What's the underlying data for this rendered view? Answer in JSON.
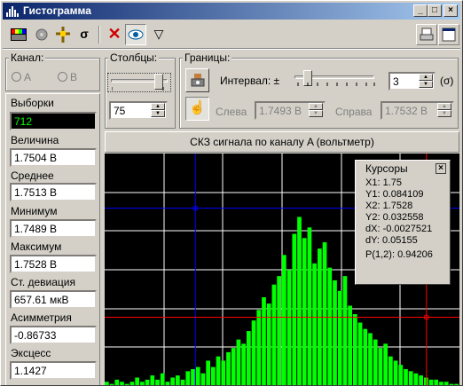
{
  "window": {
    "title": "Гистограмма"
  },
  "toolbar": {
    "tools": [
      "palette-icon",
      "gear-icon",
      "crosshair-icon",
      "sigma-icon",
      "delete-icon",
      "eye-icon",
      "triangle-icon"
    ],
    "right_tools": [
      "print-icon",
      "fullscreen-icon"
    ]
  },
  "channel": {
    "label": "Канал:",
    "a": "A",
    "b": "B"
  },
  "columns": {
    "label": "Столбцы:",
    "value": "75"
  },
  "bounds": {
    "label": "Границы:",
    "interval_label": "Интервал: ±",
    "interval_value": "3",
    "interval_unit": "(σ)",
    "left_label": "Слева",
    "left_value": "1.7493 В",
    "right_label": "Справа",
    "right_value": "1.7532 В"
  },
  "stats": {
    "samples_label": "Выборки",
    "samples_value": "712",
    "value_label": "Величина",
    "value_value": "1.7504 В",
    "mean_label": "Среднее",
    "mean_value": "1.7513 В",
    "min_label": "Минимум",
    "min_value": "1.7489 В",
    "max_label": "Максимум",
    "max_value": "1.7528 В",
    "std_label": "Ст. девиация",
    "std_value": "657.61 мкВ",
    "skew_label": "Асимметрия",
    "skew_value": "-0.86733",
    "kurt_label": "Эксцесс",
    "kurt_value": "1.1427"
  },
  "chart_title": "СКЗ сигнала по каналу A (вольтметр)",
  "cursors": {
    "title": "Курсоры",
    "x1": "X1: 1.75",
    "y1": "Y1: 0.084109",
    "x2": "X2: 1.7528",
    "y2": "Y2: 0.032558",
    "dx": "dX: -0.0027521",
    "dy": "dY: 0.05155",
    "p": "P(1,2): 0.94206"
  },
  "colors": {
    "bars": "#00ff00",
    "grid": "#ffffff",
    "cursor1": "#0000ff",
    "cursor2": "#ff0000",
    "background": "#000000"
  },
  "chart_data": {
    "type": "bar",
    "title": "СКЗ сигнала по каналу A (вольтметр)",
    "xlim": [
      1.7489,
      1.7532
    ],
    "bars": [
      2,
      1,
      3,
      2,
      1,
      2,
      4,
      2,
      3,
      5,
      3,
      6,
      2,
      4,
      5,
      3,
      7,
      8,
      9,
      6,
      12,
      9,
      14,
      12,
      16,
      18,
      22,
      20,
      26,
      31,
      36,
      42,
      39,
      48,
      52,
      62,
      55,
      72,
      80,
      70,
      75,
      58,
      65,
      68,
      56,
      50,
      45,
      52,
      38,
      34,
      30,
      27,
      25,
      22,
      18,
      20,
      14,
      12,
      10,
      8,
      7,
      6,
      5,
      4,
      3,
      3,
      2,
      2,
      1,
      1
    ],
    "cursor_x1": 1.75,
    "cursor_y1": 0.084109,
    "cursor_x2": 1.7528,
    "cursor_y2": 0.032558
  }
}
